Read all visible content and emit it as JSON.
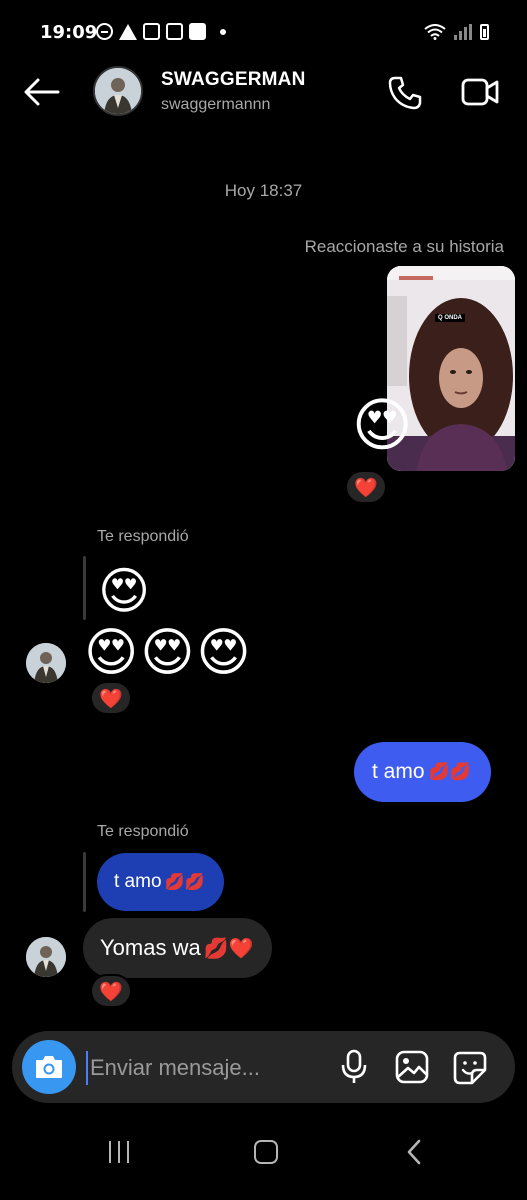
{
  "status_bar": {
    "time": "19:09",
    "icons": [
      "do-not-disturb-icon",
      "warning-icon",
      "instagram-icon",
      "instagram-icon",
      "check-box-icon",
      "dot-icon"
    ],
    "right_icons": [
      "wifi-icon",
      "signal-icon",
      "battery-icon"
    ]
  },
  "header": {
    "name": "SWAGGERMAN",
    "username": "swaggermannn",
    "back_icon": "arrow-left-icon",
    "call_icon": "phone-icon",
    "video_icon": "video-camera-icon"
  },
  "chat": {
    "timestamp": "Hoy 18:37",
    "story_reaction": {
      "caption": "Reaccionaste a su historia",
      "story_sticker_text": "Q ONDA",
      "emoji": "😍",
      "reaction": "❤️"
    },
    "reply_1": {
      "label": "Te respondió",
      "quoted_emoji": "😍",
      "message": "😍😍😍",
      "reaction": "❤️"
    },
    "sent_message": {
      "text": "t amo",
      "emojis": "💋💋"
    },
    "reply_2": {
      "label": "Te respondió",
      "quoted_text": "t amo",
      "quoted_emojis": "💋💋",
      "message_text": "Yomas wa",
      "message_emojis": "💋❤️",
      "reaction": "❤️"
    }
  },
  "composer": {
    "placeholder": "Enviar mensaje...",
    "camera_icon": "camera-icon",
    "mic_icon": "microphone-icon",
    "gallery_icon": "image-icon",
    "sticker_icon": "sticker-icon"
  },
  "nav_bar": {
    "buttons": [
      "recents-icon",
      "home-icon",
      "back-icon"
    ]
  },
  "colors": {
    "background": "#000000",
    "sent_bubble": "#3e5cf0",
    "quoted_bubble": "#1d3fb3",
    "received_bubble": "#262626",
    "camera_button": "#3897f0",
    "secondary_text": "#a8a8a8"
  }
}
